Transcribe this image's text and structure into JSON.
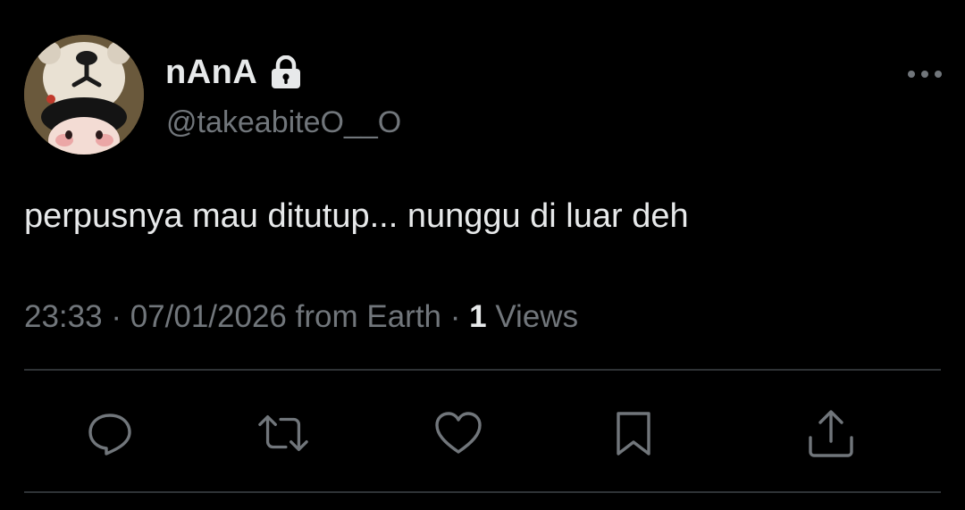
{
  "user": {
    "display_name": "nAnA",
    "handle": "@takeabiteO__O",
    "protected": true
  },
  "tweet": {
    "text": "perpusnya mau ditutup... nunggu di luar deh",
    "time": "23:33",
    "separator": "·",
    "date": "07/01/2026",
    "source": "from Earth",
    "views_count": "1",
    "views_label": "Views"
  },
  "actions": [
    "reply-icon",
    "retweet-icon",
    "like-icon",
    "bookmark-icon",
    "share-icon"
  ],
  "colors": {
    "background": "#000000",
    "primary_text": "#e7e9ea",
    "secondary_text": "#71767b",
    "divider": "#2f3336"
  }
}
